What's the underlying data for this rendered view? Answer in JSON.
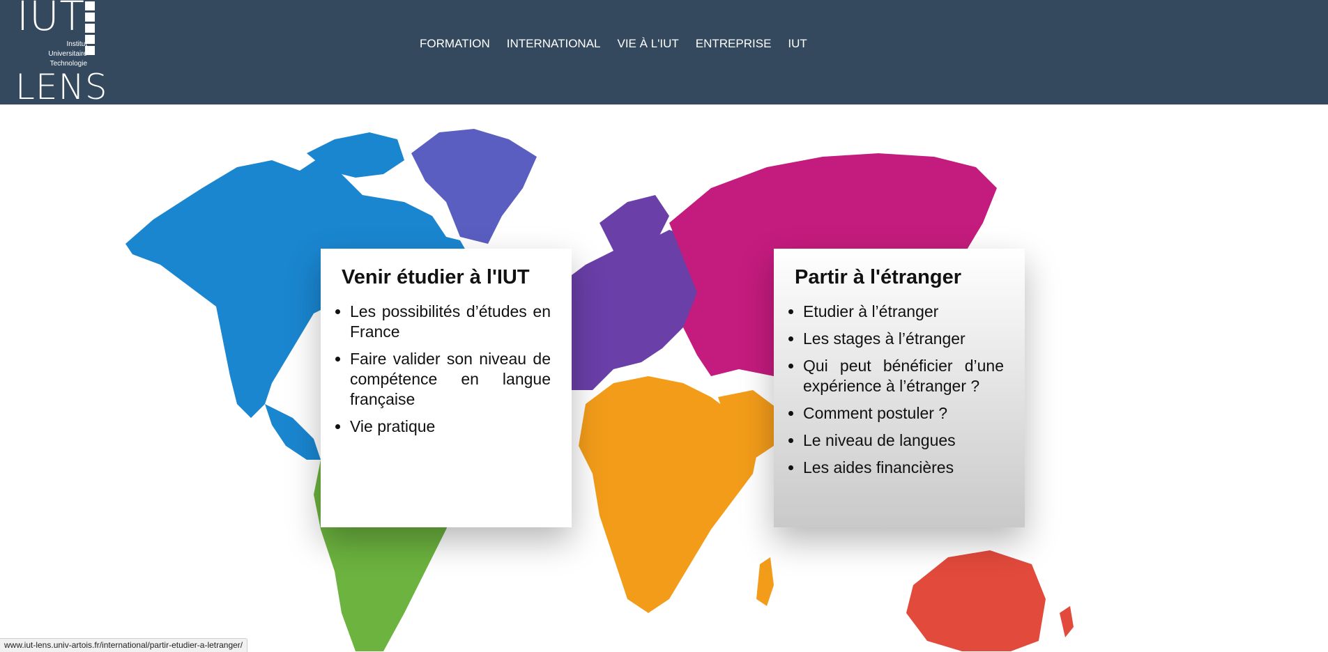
{
  "logo": {
    "top": "IUT",
    "subtitle_lines": [
      "Institut",
      "Universitaire",
      "Technologie"
    ],
    "bottom": "LENS"
  },
  "nav": {
    "items": [
      "FORMATION",
      "INTERNATIONAL",
      "VIE À L'IUT",
      "ENTREPRISE",
      "IUT"
    ]
  },
  "cards": {
    "left": {
      "title": "Venir étudier à l'IUT",
      "items": [
        "Les possibilités d’études en France",
        "Faire valider son niveau de compétence en langue française",
        "Vie pratique"
      ]
    },
    "right": {
      "title": "Partir à l'étranger",
      "items": [
        "Etudier à l’étranger",
        "Les stages à l’étranger",
        "Qui peut bénéficier d’une expérience à l’étranger ?",
        "Comment postuler ?",
        "Le niveau de langues",
        "Les aides financières"
      ]
    }
  },
  "status_url": "www.iut-lens.univ-artois.fr/international/partir-etudier-a-letranger/",
  "colors": {
    "header_bg": "#34495e",
    "north_america": "#1a86d0",
    "greenland": "#5a5ec0",
    "south_america": "#6cb33f",
    "europe": "#6a3fa8",
    "russia": "#c41b7e",
    "africa": "#f39c1a",
    "australia": "#e24a3b"
  }
}
